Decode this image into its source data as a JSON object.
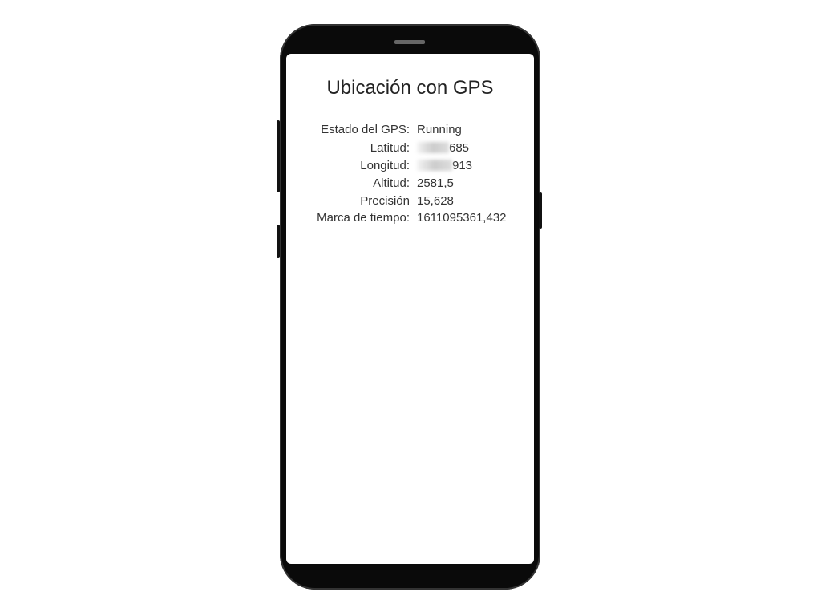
{
  "app": {
    "title": "Ubicación con GPS"
  },
  "rows": [
    {
      "label": "Estado del GPS:",
      "value": "Running"
    },
    {
      "label": "Latitud:",
      "value": "685",
      "blurred": true
    },
    {
      "label": "Longitud:",
      "value": "913",
      "blurred": true
    },
    {
      "label": "Altitud:",
      "value": "2581,5"
    },
    {
      "label": "Precisión",
      "value": "15,628"
    },
    {
      "label": "Marca de tiempo:",
      "value": "1611095361,432"
    }
  ]
}
